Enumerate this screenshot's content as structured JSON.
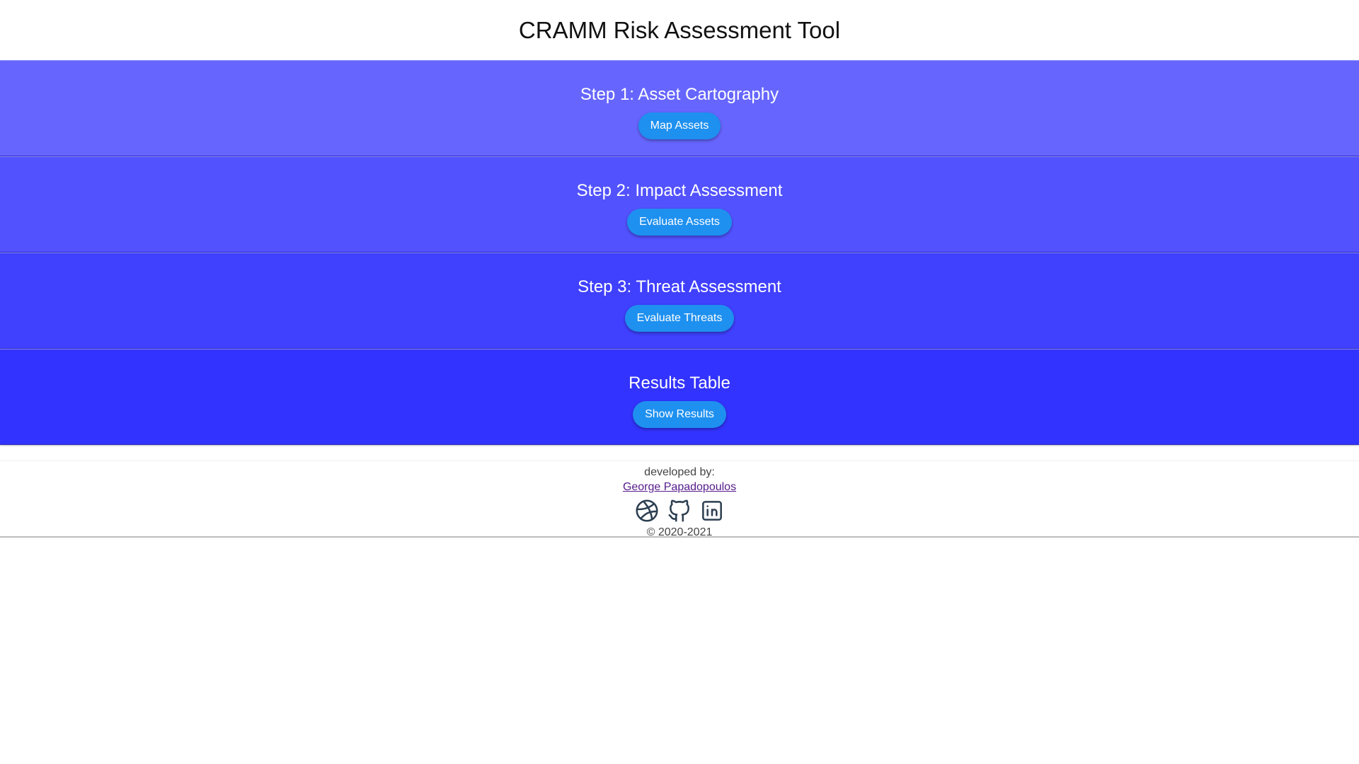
{
  "header": {
    "title": "CRAMM Risk Assessment Tool"
  },
  "steps": [
    {
      "title": "Step 1: Asset Cartography",
      "button_label": "Map Assets",
      "color": "#6666ff"
    },
    {
      "title": "Step 2: Impact Assessment",
      "button_label": "Evaluate Assets",
      "color": "#5252ff"
    },
    {
      "title": "Step 3: Threat Assessment",
      "button_label": "Evaluate Threats",
      "color": "#4040ff"
    },
    {
      "title": "Results Table",
      "button_label": "Show Results",
      "color": "#3333ff"
    }
  ],
  "footer": {
    "developed_by_label": "developed by:",
    "author_name": "George Papadopoulos",
    "social_icons": [
      "dribbble-icon",
      "github-icon",
      "linkedin-icon"
    ],
    "copyright": "© 2020-2021"
  },
  "colors": {
    "button": "#1e90f0",
    "icon_stroke": "#2c3e50",
    "link": "#551a8b"
  }
}
